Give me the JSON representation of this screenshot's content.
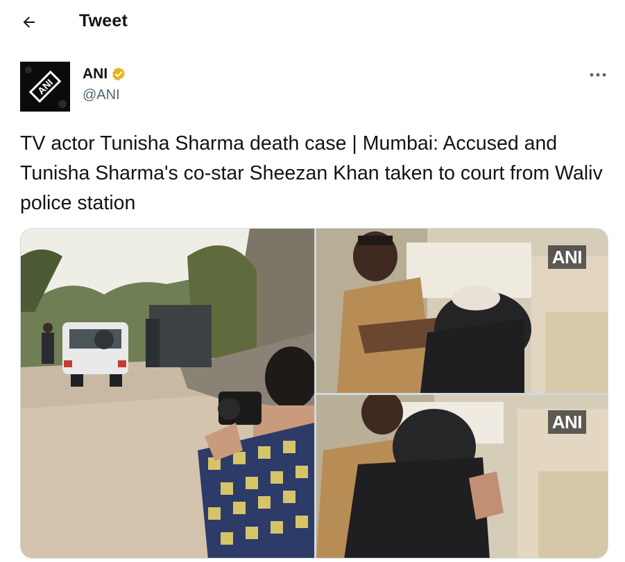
{
  "header": {
    "title": "Tweet",
    "back_icon": "arrow-left-icon"
  },
  "tweet": {
    "author": {
      "name": "ANI",
      "handle": "@ANI",
      "verified": true,
      "verified_color": "#e2b719",
      "avatar_text": "ANI"
    },
    "text": "TV actor Tunisha Sharma death case | Mumbai: Accused and Tunisha Sharma's co-star Sheezan Khan taken to court from Waliv police station",
    "more_icon": "more-horizontal-icon",
    "media": [
      {
        "watermark": ""
      },
      {
        "watermark": "ANI"
      },
      {
        "watermark": "ANI"
      }
    ]
  },
  "colors": {
    "text_primary": "#0f1419",
    "text_secondary": "#536471",
    "border": "#cfd9de"
  }
}
